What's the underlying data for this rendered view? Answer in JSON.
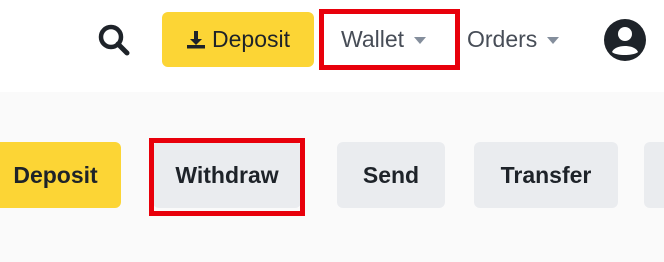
{
  "header": {
    "search_icon": "search-icon",
    "deposit_label": "Deposit",
    "deposit_icon": "download-icon",
    "nav": [
      {
        "label": "Wallet",
        "icon": "chevron-down-icon"
      },
      {
        "label": "Orders",
        "icon": "chevron-down-icon"
      }
    ],
    "account_icon": "user-circle-icon"
  },
  "actions": [
    {
      "label": "Deposit"
    },
    {
      "label": "Withdraw"
    },
    {
      "label": "Send"
    },
    {
      "label": "Transfer"
    }
  ],
  "colors": {
    "accent": "#fcd535",
    "highlight": "#e8000b",
    "button_bg": "#eaecef",
    "text": "#1e2329",
    "nav_text": "#474d57"
  }
}
